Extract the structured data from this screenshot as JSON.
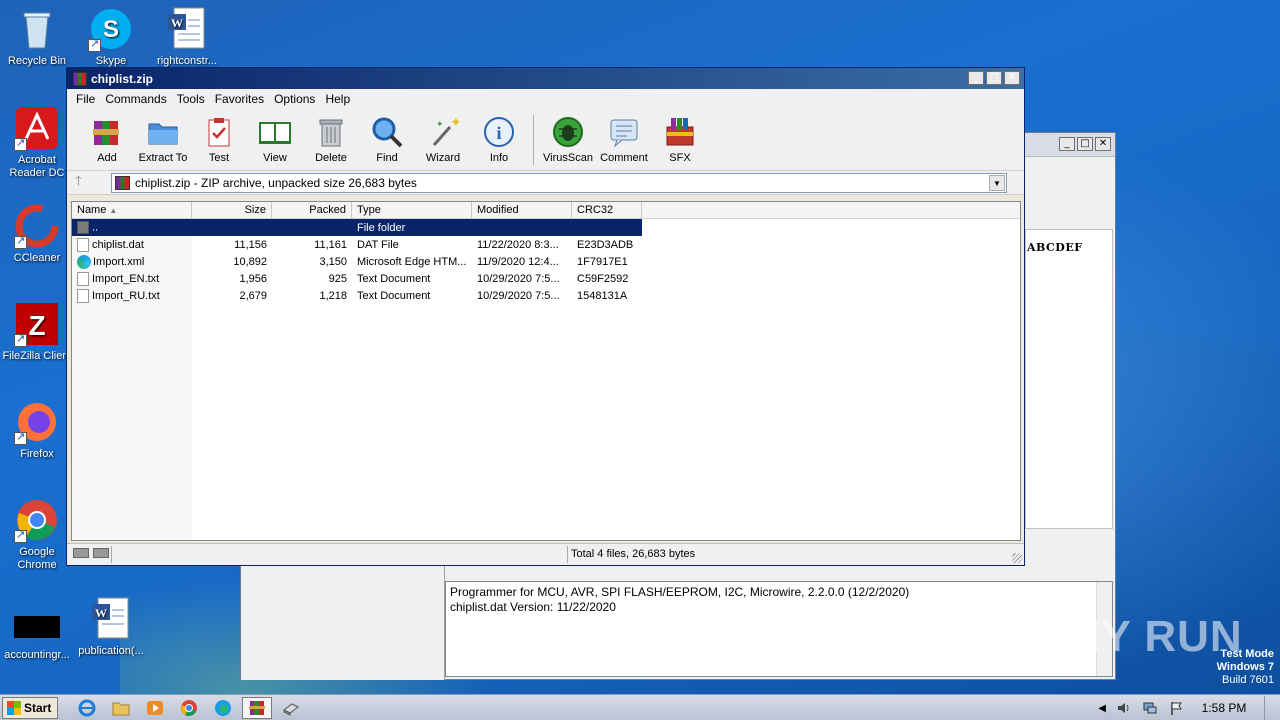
{
  "desktop": {
    "icons": [
      {
        "label": "Recycle Bin"
      },
      {
        "label": "Skype"
      },
      {
        "label": "rightconstr..."
      },
      {
        "label": "Acrobat Reader DC"
      },
      {
        "label": "CCleaner"
      },
      {
        "label": "FileZilla Client"
      },
      {
        "label": "Firefox"
      },
      {
        "label": "Google Chrome"
      },
      {
        "label": "accountingr..."
      },
      {
        "label": "publication(..."
      }
    ]
  },
  "background_window": {
    "hex_header": "ABCDEF",
    "log_lines": [
      "Programmer for MCU, AVR, SPI FLASH/EEPROM, I2C, Microwire, 2.2.0.0 (12/2/2020)",
      "chiplist.dat Version: 11/22/2020"
    ]
  },
  "winrar": {
    "title": "chiplist.zip",
    "menu": [
      "File",
      "Commands",
      "Tools",
      "Favorites",
      "Options",
      "Help"
    ],
    "toolbar": [
      "Add",
      "Extract To",
      "Test",
      "View",
      "Delete",
      "Find",
      "Wizard",
      "Info",
      "VirusScan",
      "Comment",
      "SFX"
    ],
    "address": "chiplist.zip - ZIP archive, unpacked size 26,683 bytes",
    "columns": [
      "Name",
      "Size",
      "Packed",
      "Type",
      "Modified",
      "CRC32"
    ],
    "rows": [
      {
        "name": "..",
        "size": "",
        "packed": "",
        "type": "File folder",
        "modified": "",
        "crc": ""
      },
      {
        "name": "chiplist.dat",
        "size": "11,156",
        "packed": "11,161",
        "type": "DAT File",
        "modified": "11/22/2020 8:3...",
        "crc": "E23D3ADB"
      },
      {
        "name": "Import.xml",
        "size": "10,892",
        "packed": "3,150",
        "type": "Microsoft Edge HTM...",
        "modified": "11/9/2020 12:4...",
        "crc": "1F7917E1"
      },
      {
        "name": "Import_EN.txt",
        "size": "1,956",
        "packed": "925",
        "type": "Text Document",
        "modified": "10/29/2020 7:5...",
        "crc": "C59F2592"
      },
      {
        "name": "Import_RU.txt",
        "size": "2,679",
        "packed": "1,218",
        "type": "Text Document",
        "modified": "10/29/2020 7:5...",
        "crc": "1548131A"
      }
    ],
    "status": "Total 4 files, 26,683 bytes"
  },
  "taskbar": {
    "start": "Start",
    "clock": "1:58 PM"
  },
  "watermark": {
    "line1": "Test Mode",
    "line2": "Windows 7",
    "line3": "Build 7601",
    "brand": "ANY RUN"
  }
}
